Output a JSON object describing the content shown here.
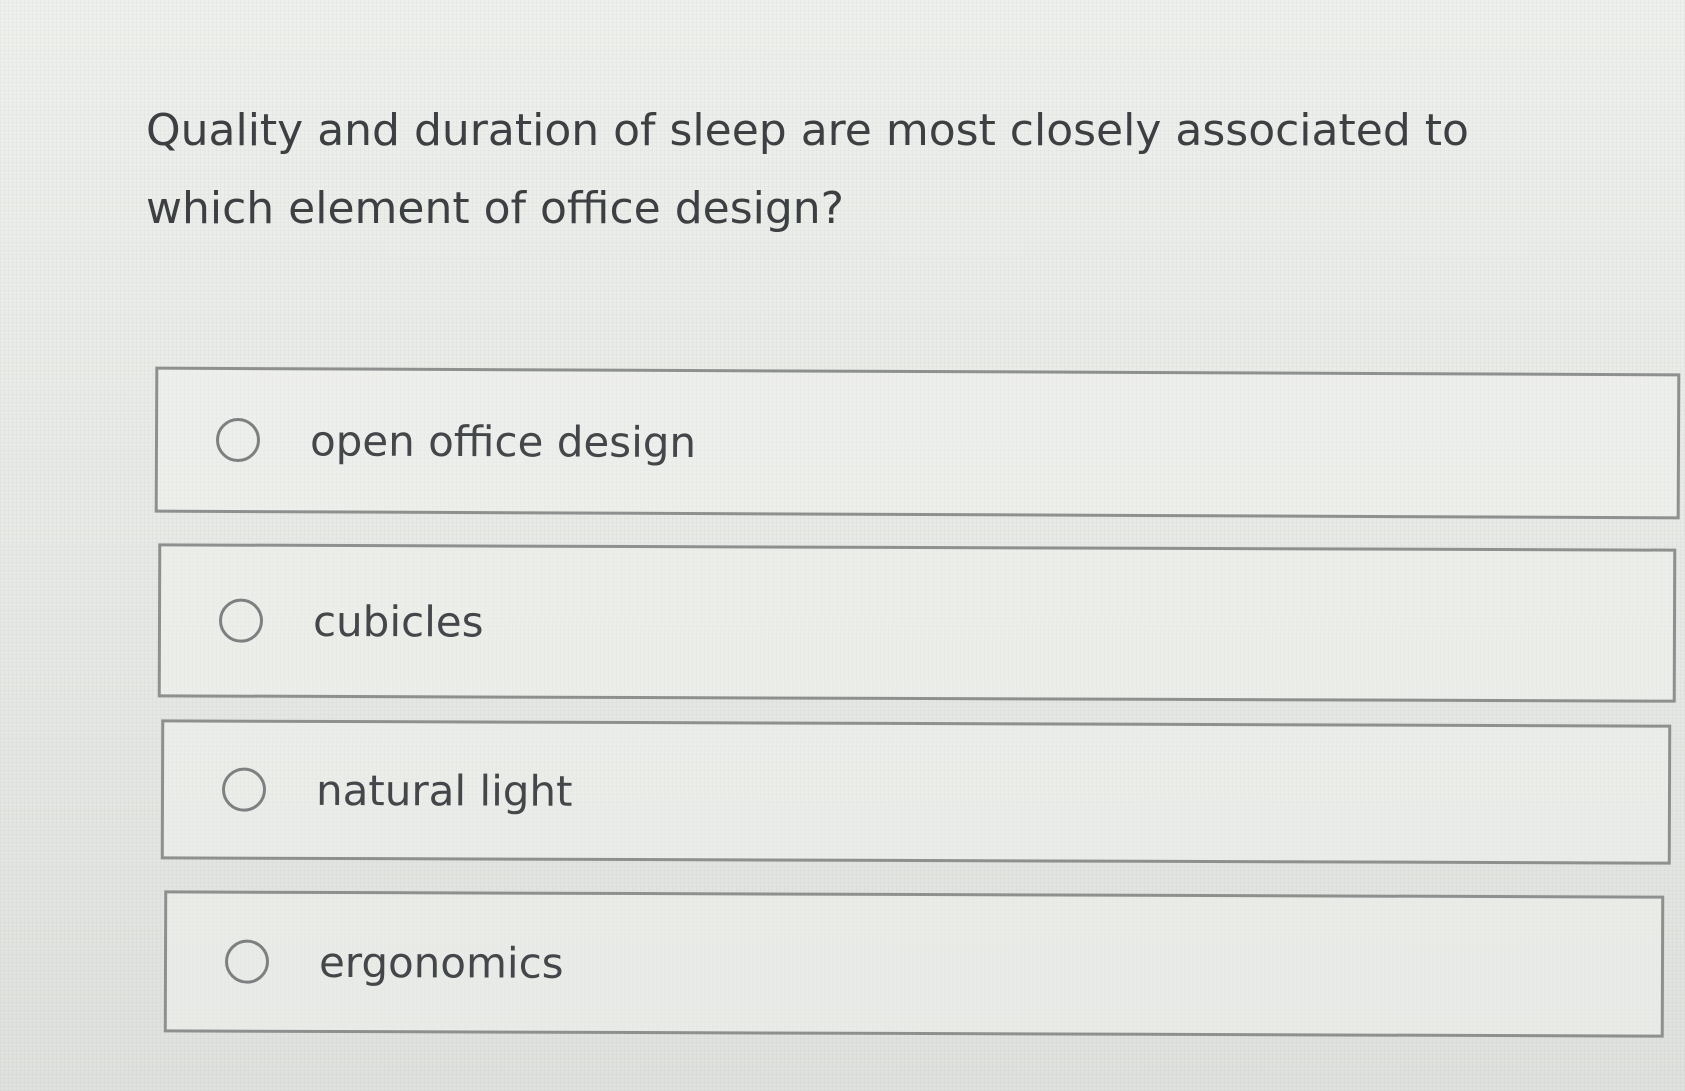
{
  "question": {
    "text": "Quality and duration of sleep are most closely associated to which element of office design?"
  },
  "options": [
    {
      "label": "open office design",
      "selected": false
    },
    {
      "label": "cubicles",
      "selected": false
    },
    {
      "label": "natural light",
      "selected": false
    },
    {
      "label": "ergonomics",
      "selected": false
    }
  ],
  "colors": {
    "background": "#e9ebe8",
    "text": "#3d4042",
    "border": "#8e9090"
  }
}
